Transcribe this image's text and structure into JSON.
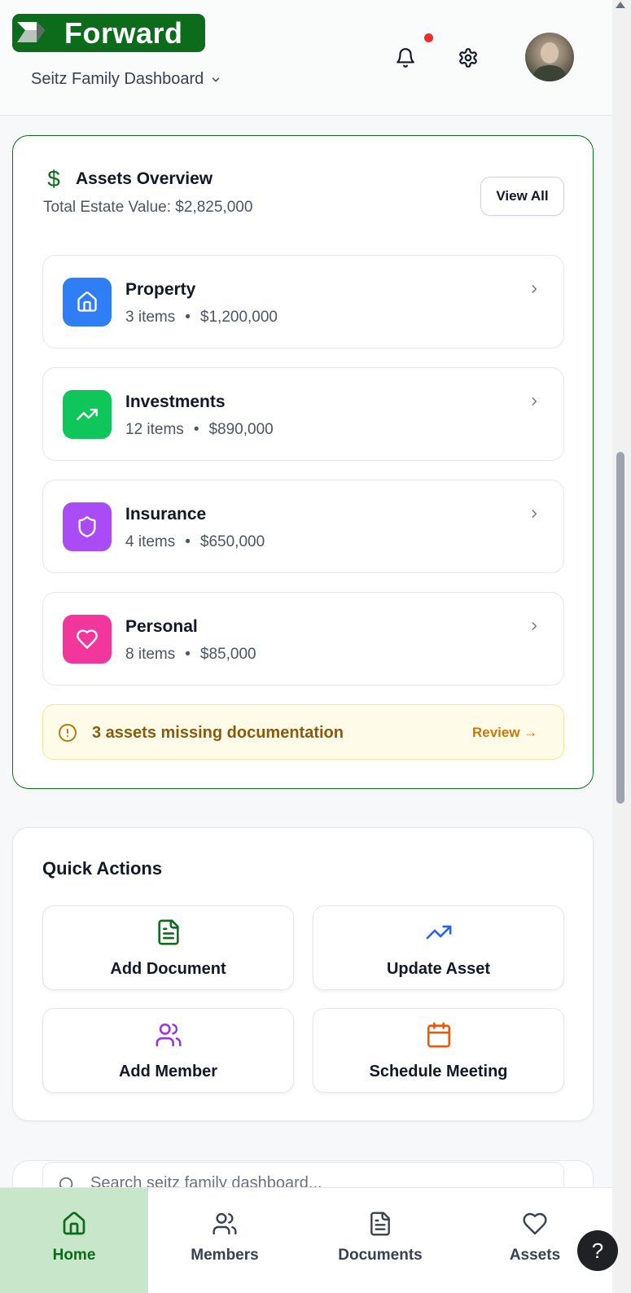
{
  "header": {
    "logo_text": "Forward",
    "dashboard_name": "Seitz Family Dashboard",
    "has_notification": true
  },
  "assets_overview": {
    "title": "Assets Overview",
    "total_label": "Total Estate Value: $2,825,000",
    "view_all_label": "View All",
    "categories": [
      {
        "name": "Property",
        "items": "3 items",
        "value": "$1,200,000",
        "icon": "home-icon",
        "color": "#2f7ef5"
      },
      {
        "name": "Investments",
        "items": "12 items",
        "value": "$890,000",
        "icon": "trending-up-icon",
        "color": "#0fc65a"
      },
      {
        "name": "Insurance",
        "items": "4 items",
        "value": "$650,000",
        "icon": "shield-icon",
        "color": "#a94cf5"
      },
      {
        "name": "Personal",
        "items": "8 items",
        "value": "$85,000",
        "icon": "heart-icon",
        "color": "#f1379c"
      }
    ],
    "separator": "•",
    "warning_text": "3 assets missing documentation",
    "review_label": "Review →"
  },
  "quick_actions": {
    "title": "Quick Actions",
    "actions": [
      {
        "label": "Add Document",
        "icon": "file-text-icon",
        "color": "#0d6b1c"
      },
      {
        "label": "Update Asset",
        "icon": "trending-up-icon",
        "color": "#2563eb"
      },
      {
        "label": "Add Member",
        "icon": "users-icon",
        "color": "#9333ea"
      },
      {
        "label": "Schedule Meeting",
        "icon": "calendar-icon",
        "color": "#ea580c"
      }
    ]
  },
  "search": {
    "placeholder": "Search seitz family dashboard..."
  },
  "bottom_nav": {
    "items": [
      {
        "label": "Home",
        "icon": "home-icon",
        "active": true
      },
      {
        "label": "Members",
        "icon": "users-icon",
        "active": false
      },
      {
        "label": "Documents",
        "icon": "file-text-icon",
        "active": false
      },
      {
        "label": "Assets",
        "icon": "heart-icon",
        "active": false
      }
    ]
  },
  "help": {
    "label": "?"
  },
  "colors": {
    "brand_green": "#0d6b1c",
    "nav_active_bg": "#c8e6c9",
    "warning_bg": "#fefbe8",
    "warning_text": "#8a5a0b",
    "notification_dot": "#ef2b2b"
  }
}
